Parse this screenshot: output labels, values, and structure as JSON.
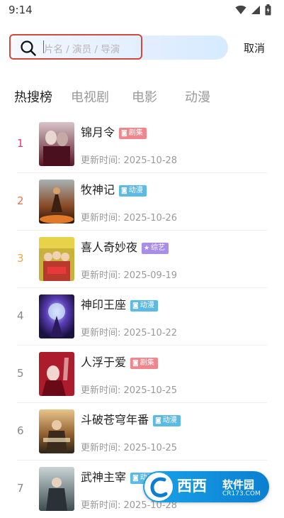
{
  "status_bar": {
    "time": "9:14",
    "icons": [
      "wifi-icon",
      "signal-icon",
      "battery-icon"
    ]
  },
  "search": {
    "placeholder": "片名 / 演员 / 导演",
    "cancel_label": "取消"
  },
  "tabs": [
    {
      "label": "热搜榜",
      "active": true
    },
    {
      "label": "电视剧",
      "active": false
    },
    {
      "label": "电影",
      "active": false
    },
    {
      "label": "动漫",
      "active": false
    }
  ],
  "colors": {
    "rank_1": "#e5397c",
    "rank_2": "#f07050",
    "rank_3": "#f4a340",
    "rank_other": "#888888",
    "badge_drama": "#f0868c",
    "badge_anime": "#5bbbe6",
    "badge_variety": "#a88ee8"
  },
  "list": [
    {
      "rank": "1",
      "title": "锦月令",
      "badge": "剧集",
      "badge_type": "drama",
      "update": "更新时间: 2025-10-28"
    },
    {
      "rank": "2",
      "title": "牧神记",
      "badge": "动漫",
      "badge_type": "anime",
      "update": "更新时间: 2025-10-26"
    },
    {
      "rank": "3",
      "title": "喜人奇妙夜",
      "badge": "综艺",
      "badge_type": "variety",
      "update": "更新时间: 2025-09-19"
    },
    {
      "rank": "4",
      "title": "神印王座",
      "badge": "动漫",
      "badge_type": "anime",
      "update": "更新时间: 2025-10-22"
    },
    {
      "rank": "5",
      "title": "人浮于爱",
      "badge": "剧集",
      "badge_type": "drama",
      "update": "更新时间: 2025-10-25"
    },
    {
      "rank": "6",
      "title": "斗破苍穹年番",
      "badge": "动漫",
      "badge_type": "anime",
      "update": "更新时间: 2025-10-25"
    },
    {
      "rank": "7",
      "title": "武神主宰",
      "badge": "动漫",
      "badge_type": "anime",
      "update": "更新时间: 2025-10-28"
    }
  ],
  "watermark": {
    "brand": "西西",
    "subtitle": "软件园",
    "url": "CR173.COM"
  }
}
